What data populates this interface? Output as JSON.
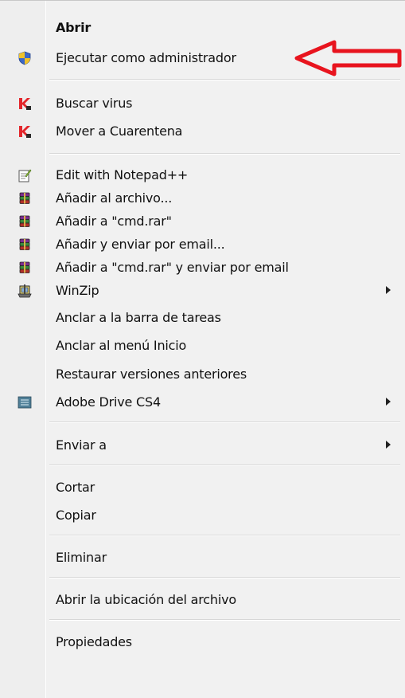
{
  "menu": {
    "items": [
      {
        "label": "Abrir",
        "bold": true
      },
      {
        "label": "Ejecutar como administrador",
        "icon": "shield-icon"
      },
      {
        "label": "Buscar virus",
        "icon": "kaspersky-icon"
      },
      {
        "label": "Mover a Cuarentena",
        "icon": "kaspersky-icon"
      },
      {
        "label": "Edit with Notepad++",
        "icon": "notepad-icon"
      },
      {
        "label": "Añadir al archivo...",
        "icon": "winrar-icon"
      },
      {
        "label": "Añadir a \"cmd.rar\"",
        "icon": "winrar-icon"
      },
      {
        "label": "Añadir y enviar por email...",
        "icon": "winrar-icon"
      },
      {
        "label": "Añadir a \"cmd.rar\" y enviar por email",
        "icon": "winrar-icon"
      },
      {
        "label": "WinZip",
        "icon": "winzip-icon",
        "submenu": true
      },
      {
        "label": "Anclar a la barra de tareas"
      },
      {
        "label": "Anclar al menú Inicio"
      },
      {
        "label": "Restaurar versiones anteriores"
      },
      {
        "label": "Adobe Drive CS4",
        "icon": "adobe-drive-icon",
        "submenu": true
      },
      {
        "label": "Enviar a",
        "submenu": true
      },
      {
        "label": "Cortar"
      },
      {
        "label": "Copiar"
      },
      {
        "label": "Eliminar"
      },
      {
        "label": "Abrir la ubicación del archivo"
      },
      {
        "label": "Propiedades"
      }
    ]
  },
  "colors": {
    "menu_background": "#f1f1f1",
    "annotation_arrow": "#e8141e",
    "kaspersky_red": "#e3262b"
  }
}
